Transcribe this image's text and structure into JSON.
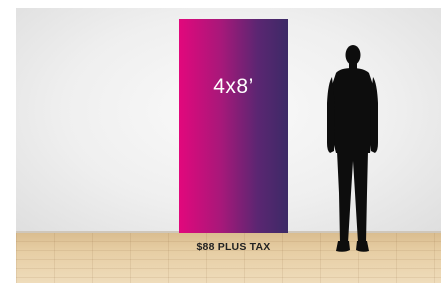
{
  "scene": {
    "banner": {
      "size_label": "4x8’",
      "gradient_colors": [
        "#e2087c",
        "#a8187a",
        "#5b2672",
        "#3c2a66"
      ]
    },
    "price_label": "$88 PLUS TAX",
    "silhouette_color": "#0d0d0d"
  }
}
